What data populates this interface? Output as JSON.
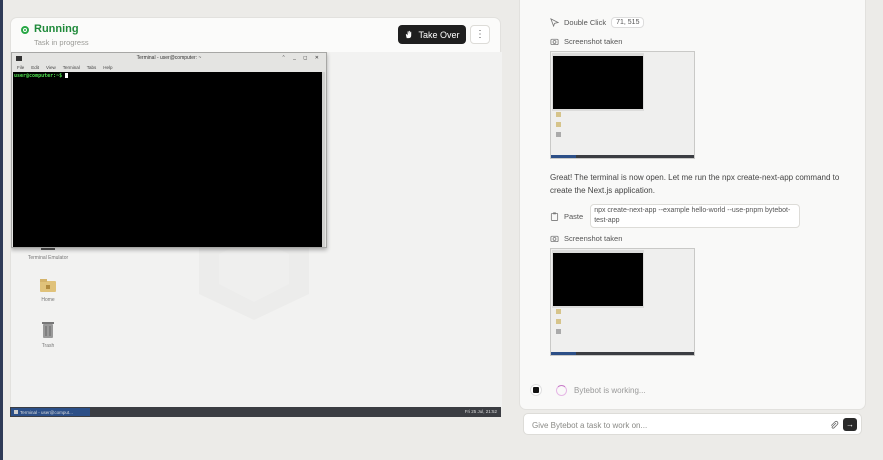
{
  "status": {
    "title": "Running",
    "subtitle": "Task in progress",
    "color": "#28a745"
  },
  "header": {
    "takeover_label": "Take Over",
    "menu_icon": "more-vertical-icon"
  },
  "desktop": {
    "terminal": {
      "title": "Terminal - user@computer: ~",
      "menu": [
        "File",
        "Edit",
        "View",
        "Terminal",
        "Tabs",
        "Help"
      ],
      "prompt": "user@computer:~$"
    },
    "icons": [
      {
        "label": "Terminal Emulator",
        "icon": "terminal-icon"
      },
      {
        "label": "Home",
        "icon": "home-folder-icon"
      },
      {
        "label": "Trash",
        "icon": "trash-icon"
      }
    ],
    "taskbar": {
      "item": "Terminal - user@comput...",
      "clock": "Fri 25 Jul, 21:52"
    }
  },
  "chat": {
    "action1": {
      "label": "Double Click",
      "coords": "71, 515"
    },
    "screenshot1": "Screenshot taken",
    "message": "Great! The terminal is now open. Let me run the npx create-next-app command to create the Next.js application.",
    "paste": {
      "label": "Paste",
      "text": "npx create-next-app --example hello-world --use-pnpm bytebot-test-app"
    },
    "screenshot2": "Screenshot taken",
    "working": "Bytebot is working..."
  },
  "input": {
    "placeholder": "Give Bytebot a task to work on..."
  }
}
